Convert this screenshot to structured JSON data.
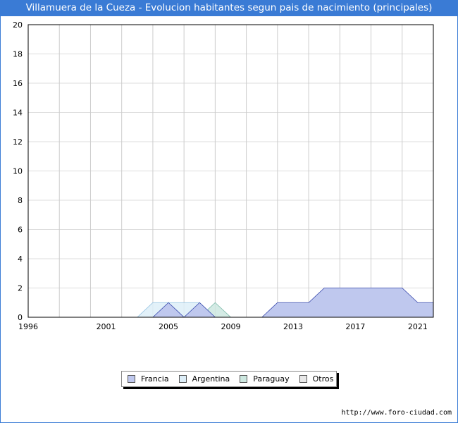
{
  "page": {
    "title": "Villamuera de la Cueza - Evolucion habitantes segun pais de nacimiento (principales)",
    "footer": "http://www.foro-ciudad.com"
  },
  "chart_data": {
    "type": "area",
    "title": "Villamuera de la Cueza - Evolucion habitantes segun pais de nacimiento (principales)",
    "xlabel": "",
    "ylabel": "",
    "x": [
      1996,
      1997,
      1998,
      1999,
      2000,
      2001,
      2002,
      2003,
      2004,
      2005,
      2006,
      2007,
      2008,
      2009,
      2010,
      2011,
      2012,
      2013,
      2014,
      2015,
      2016,
      2017,
      2018,
      2019,
      2020,
      2021,
      2022
    ],
    "xlim": [
      1996,
      2022
    ],
    "ylim": [
      0,
      20
    ],
    "xticks": [
      "1996",
      "2001",
      "2005",
      "2009",
      "2013",
      "2017",
      "2021"
    ],
    "xtick_values": [
      1996,
      2001,
      2005,
      2009,
      2013,
      2017,
      2021
    ],
    "yticks": [
      "0",
      "2",
      "4",
      "6",
      "8",
      "10",
      "12",
      "14",
      "16",
      "18",
      "20"
    ],
    "ytick_values": [
      0,
      2,
      4,
      6,
      8,
      10,
      12,
      14,
      16,
      18,
      20
    ],
    "grid": true,
    "legend_position": "bottom",
    "series": [
      {
        "name": "Francia",
        "color": "#bfc8ee",
        "stroke": "#3344aa",
        "x": [
          2004,
          2005,
          2006,
          2007,
          2008,
          2011,
          2012,
          2013,
          2014,
          2015,
          2016,
          2017,
          2018,
          2019,
          2020,
          2021,
          2022
        ],
        "values": [
          0,
          1,
          0,
          1,
          0,
          0,
          1,
          1,
          1,
          2,
          2,
          2,
          2,
          2,
          2,
          1,
          1
        ]
      },
      {
        "name": "Argentina",
        "color": "#ddeef8",
        "stroke": "#8fbfe0",
        "x": [
          2003,
          2004,
          2005,
          2006,
          2007,
          2008
        ],
        "values": [
          0,
          1,
          1,
          1,
          1,
          0
        ]
      },
      {
        "name": "Paraguay",
        "color": "#cde8e0",
        "stroke": "#7ab8a8",
        "x": [
          2007,
          2008,
          2009
        ],
        "values": [
          0,
          1,
          0
        ]
      },
      {
        "name": "Otros",
        "color": "#e8e8e8",
        "stroke": "#888888",
        "x": [],
        "values": []
      }
    ]
  }
}
